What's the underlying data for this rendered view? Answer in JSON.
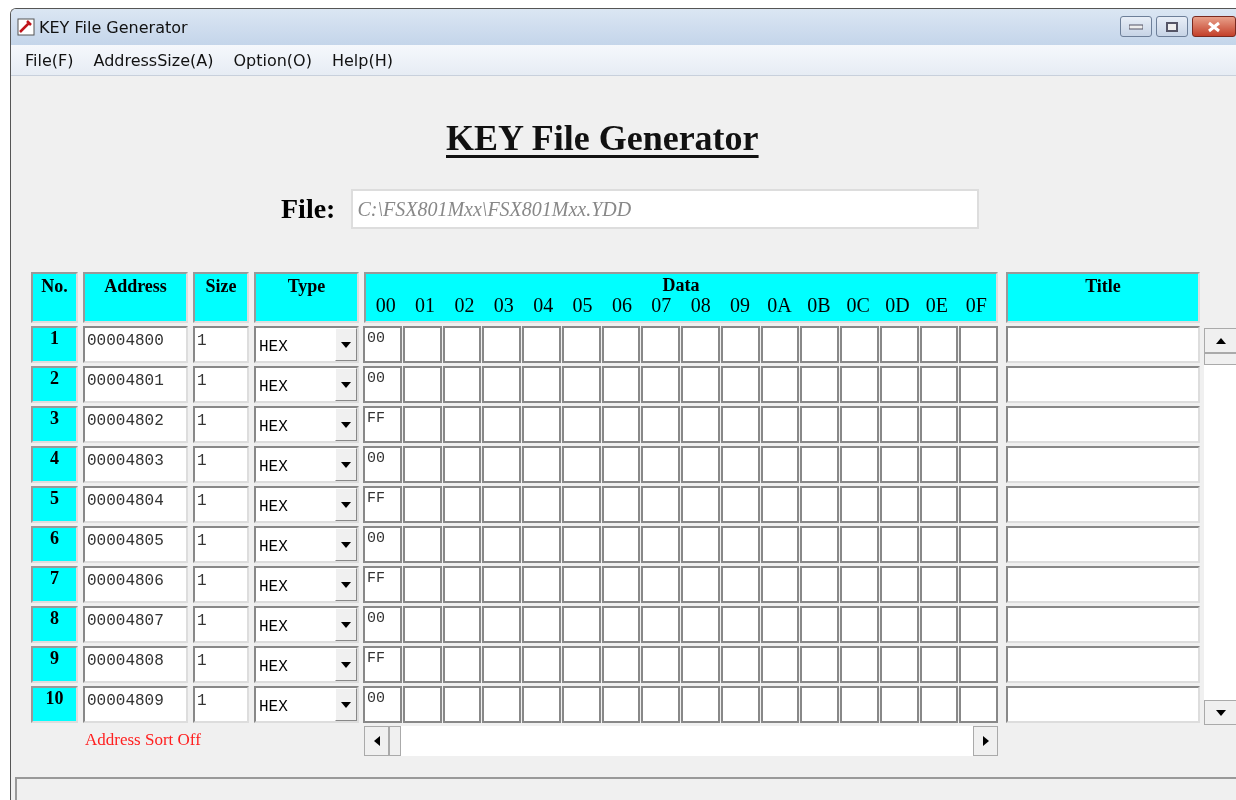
{
  "window": {
    "title": "KEY File Generator"
  },
  "menu": [
    "File(F)",
    "AddressSize(A)",
    "Option(O)",
    "Help(H)"
  ],
  "heading": "KEY File Generator",
  "file": {
    "label": "File:",
    "value": "C:\\FSX801Mxx\\FSX801Mxx.YDD"
  },
  "table": {
    "columns": [
      "No.",
      "Address",
      "Size",
      "Type",
      "Data",
      "Title"
    ],
    "data_columns": [
      "00",
      "01",
      "02",
      "03",
      "04",
      "05",
      "06",
      "07",
      "08",
      "09",
      "0A",
      "0B",
      "0C",
      "0D",
      "0E",
      "0F"
    ],
    "rows": [
      {
        "no": "1",
        "address": "00004800",
        "size": "1",
        "type": "HEX",
        "data_00": "00"
      },
      {
        "no": "2",
        "address": "00004801",
        "size": "1",
        "type": "HEX",
        "data_00": "00"
      },
      {
        "no": "3",
        "address": "00004802",
        "size": "1",
        "type": "HEX",
        "data_00": "FF"
      },
      {
        "no": "4",
        "address": "00004803",
        "size": "1",
        "type": "HEX",
        "data_00": "00"
      },
      {
        "no": "5",
        "address": "00004804",
        "size": "1",
        "type": "HEX",
        "data_00": "FF"
      },
      {
        "no": "6",
        "address": "00004805",
        "size": "1",
        "type": "HEX",
        "data_00": "00"
      },
      {
        "no": "7",
        "address": "00004806",
        "size": "1",
        "type": "HEX",
        "data_00": "FF"
      },
      {
        "no": "8",
        "address": "00004807",
        "size": "1",
        "type": "HEX",
        "data_00": "00"
      },
      {
        "no": "9",
        "address": "00004808",
        "size": "1",
        "type": "HEX",
        "data_00": "FF"
      },
      {
        "no": "10",
        "address": "00004809",
        "size": "1",
        "type": "HEX",
        "data_00": "00"
      }
    ]
  },
  "sort_status": "Address Sort Off"
}
